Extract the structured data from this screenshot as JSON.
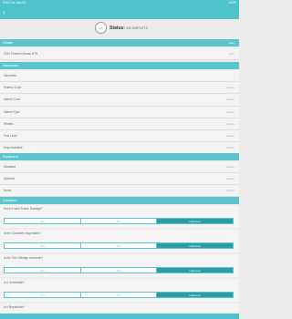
{
  "statusbar": {
    "left": "iPad  Tue Jan 00",
    "right": "100%"
  },
  "nav": {
    "back_glyph": "‹"
  },
  "header": {
    "circle_text": "0%",
    "title": "Status:",
    "status_value": "INCOMPLETE"
  },
  "sections": {
    "details": {
      "title": "Details",
      "right": "Edit ›"
    },
    "information": {
      "title": "Information"
    },
    "equipment": {
      "title": "Equipment"
    },
    "questions": {
      "title": "Questions"
    }
  },
  "details_row": {
    "label": "2016 Porsche Macan BTS",
    "action": "Edit ›"
  },
  "info_rows": [
    {
      "label": "Odometer",
      "action": "›"
    },
    {
      "label": "Exterior Color",
      "action": "Select ›"
    },
    {
      "label": "Interior Color",
      "action": "Select ›"
    },
    {
      "label": "Interior Type",
      "action": "Select ›"
    },
    {
      "label": "Wheels",
      "action": "Select ›"
    },
    {
      "label": "Fuel Level",
      "action": "Select ›"
    },
    {
      "label": "Keys Available",
      "action": "Select ›"
    }
  ],
  "equipment_rows": [
    {
      "label": "Standard",
      "action": "Select ›"
    },
    {
      "label": "Optional",
      "action": "Select ›"
    },
    {
      "label": "Notes",
      "action": "Select ›"
    }
  ],
  "questions": [
    {
      "label": "Does it have Frame Damage?",
      "options": [
        "Yes",
        "No",
        "Unknown"
      ],
      "selected": 2
    },
    {
      "label": "Is the Odometer Inoperable?",
      "options": [
        "Yes",
        "No",
        "Unknown"
      ],
      "selected": 2
    },
    {
      "label": "Is the True Mileage Unknown?",
      "options": [
        "Yes",
        "No",
        "Unknown"
      ],
      "selected": 2
    },
    {
      "label": "Is it Undrivable?",
      "options": [
        "Yes",
        "No",
        "Unknown"
      ],
      "selected": 2
    },
    {
      "label": "Is it Repairable?",
      "options": [],
      "selected": -1
    }
  ],
  "colors": {
    "accent": "#4fc3cb",
    "selected": "#2e9ca6",
    "row_bg": "#f4f4f4",
    "page_bg": "#ececec"
  }
}
